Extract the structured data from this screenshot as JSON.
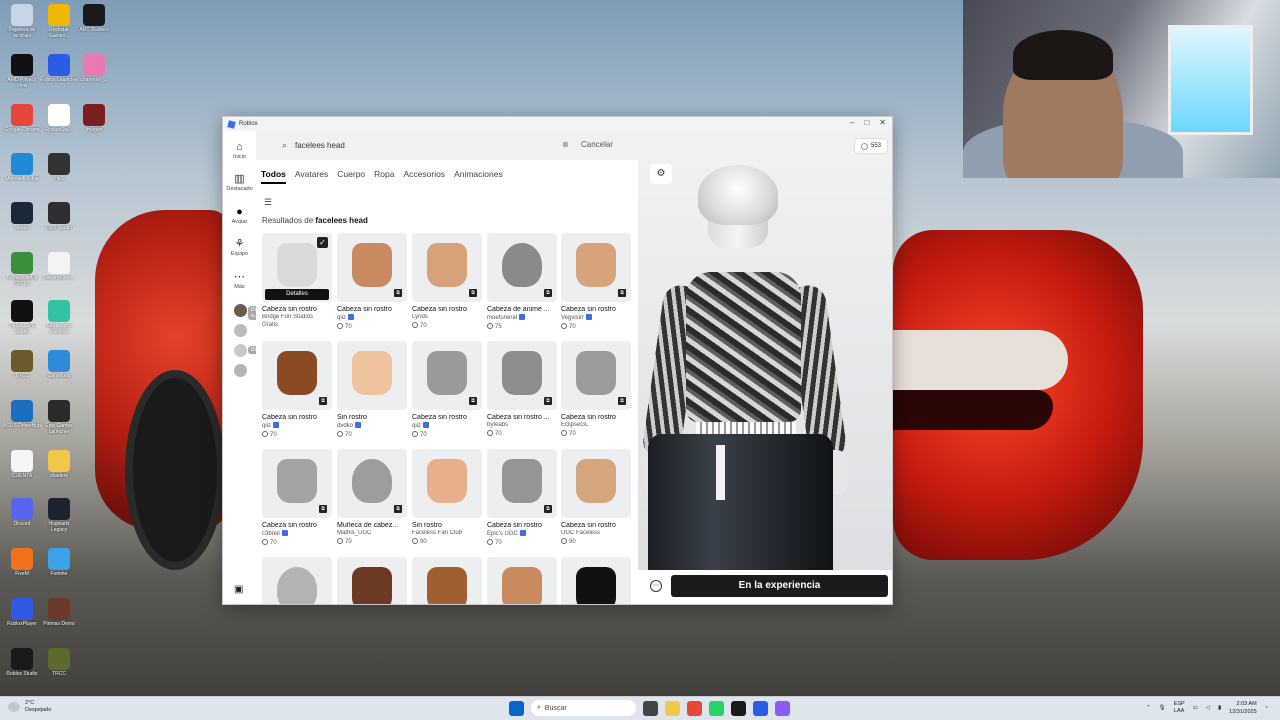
{
  "desktop": {
    "icons": [
      {
        "label": "Papelera de reciclaje",
        "color": "#c7d6e6"
      },
      {
        "label": "Rockstar Games...",
        "color": "#f2b705"
      },
      {
        "label": "ARC Raiders",
        "color": "#1a1a1a"
      },
      {
        "label": "AMD Privacy View",
        "color": "#111111"
      },
      {
        "label": "Roblox Launcher",
        "color": "#2d5be3"
      },
      {
        "label": "chanrexx_...",
        "color": "#e87ab0"
      },
      {
        "label": "Google Chrome",
        "color": "#e9463a"
      },
      {
        "label": "RobloxStu...",
        "color": "#ffffff"
      },
      {
        "label": "Imágen",
        "color": "#7a1f1f"
      },
      {
        "label": "Microsoft Edge",
        "color": "#1e8ad8"
      },
      {
        "label": "HitS",
        "color": "#333333"
      },
      {
        "label": "Steam",
        "color": "#1b2838"
      },
      {
        "label": "OBS Studio",
        "color": "#302e31"
      },
      {
        "label": "TechPowerUp GPU-Z",
        "color": "#3b8f3b"
      },
      {
        "label": "StreamElem...",
        "color": "#f3f3f3"
      },
      {
        "label": "TikTok LIVE Studio",
        "color": "#111111"
      },
      {
        "label": "Streamlabs Desktop",
        "color": "#31c3a2"
      },
      {
        "label": "TRCC",
        "color": "#6a5a2c"
      },
      {
        "label": "Gameloop",
        "color": "#2f8ad8"
      },
      {
        "label": "ASUS DriverHub",
        "color": "#1b6fc2"
      },
      {
        "label": "Epic Games Launcher",
        "color": "#2a2a2a"
      },
      {
        "label": "CUENTA",
        "color": "#f5f5f5"
      },
      {
        "label": "shaders",
        "color": "#f3c84a"
      },
      {
        "label": "Discord",
        "color": "#5865f2"
      },
      {
        "label": "Hogwarts Legacy",
        "color": "#1d2430"
      },
      {
        "label": "FiveM",
        "color": "#f2711c"
      },
      {
        "label": "Fortnite",
        "color": "#3da3e8"
      },
      {
        "label": "RobloxPlayer",
        "color": "#2d5be3"
      },
      {
        "label": "Pirimas Demo",
        "color": "#6b3a2a"
      },
      {
        "label": "Roblox Studio",
        "color": "#1a1a1a"
      },
      {
        "label": "TRCC",
        "color": "#5a6b2c"
      }
    ]
  },
  "window": {
    "title": "Roblox",
    "controls": {
      "minimize": "–",
      "maximize": "□",
      "close": "✕"
    }
  },
  "sidebar": {
    "items": [
      {
        "label": "Inicio",
        "icon": "⌂"
      },
      {
        "label": "Destacado",
        "icon": "▥"
      },
      {
        "label": "Avatar",
        "icon": "●"
      },
      {
        "label": "Equipo",
        "icon": "⚘"
      },
      {
        "label": "Más",
        "icon": "⋯"
      }
    ],
    "popups": [
      "Diseñar a...",
      "Diseñar"
    ],
    "bottom_icon": "▣"
  },
  "search": {
    "query": "facelees head",
    "clear_icon": "⊗",
    "cancel_label": "Cancelar"
  },
  "robux": {
    "amount": "553"
  },
  "tabs": [
    "Todos",
    "Avatares",
    "Cuerpo",
    "Ropa",
    "Accesorios",
    "Animaciones"
  ],
  "results": {
    "prefix": "Resultados de ",
    "query": "facelees head"
  },
  "details_label": "Detalles",
  "items": [
    {
      "name": "Cabeza sin rostro",
      "creator": "Bridge Fun Studios",
      "verified": false,
      "price": "Gratis",
      "color": "#d9d9d9",
      "badge": false,
      "selected": true
    },
    {
      "name": "Cabeza sin rostro",
      "creator": "qiiz",
      "verified": true,
      "price": "70",
      "color": "#c98a62",
      "badge": true,
      "selected": false
    },
    {
      "name": "Cabeza sin rostro",
      "creator": "Lyrids",
      "verified": false,
      "price": "70",
      "color": "#d7a27a",
      "badge": true,
      "selected": false
    },
    {
      "name": "Cabeza de anime ...",
      "creator": "moefuneral",
      "verified": true,
      "price": "75",
      "color": "#8a8a8a",
      "badge": true,
      "selected": false,
      "bald": true
    },
    {
      "name": "Cabeza sin rostro",
      "creator": "Vegvisirr",
      "verified": true,
      "price": "70",
      "color": "#d6a37c",
      "badge": true,
      "selected": false
    },
    {
      "name": "Cabeza sin rostro",
      "creator": "qiiz",
      "verified": true,
      "price": "70",
      "color": "#8b4a24",
      "badge": true,
      "selected": false
    },
    {
      "name": "Sin rostro",
      "creator": "dvdko",
      "verified": true,
      "price": "70",
      "color": "#efc39d",
      "badge": false,
      "selected": false
    },
    {
      "name": "Cabeza sin rostro",
      "creator": "qiiz",
      "verified": true,
      "price": "70",
      "color": "#9a9a9a",
      "badge": true,
      "selected": false
    },
    {
      "name": "Cabeza sin rostro ...",
      "creator": "byteabs",
      "verified": false,
      "price": "70",
      "color": "#8d8d8d",
      "badge": true,
      "selected": false
    },
    {
      "name": "Cabeza sin rostro",
      "creator": "EclipseGL",
      "verified": false,
      "price": "70",
      "color": "#9b9b9b",
      "badge": true,
      "selected": false
    },
    {
      "name": "Cabeza sin rostro",
      "creator": "c3breil",
      "verified": true,
      "price": "70",
      "color": "#a3a3a3",
      "badge": true,
      "selected": false
    },
    {
      "name": "Muñeca de cabez...",
      "creator": "Mathis_UGC",
      "verified": false,
      "price": "70",
      "color": "#9d9d9d",
      "badge": true,
      "selected": false,
      "bald": true
    },
    {
      "name": "Sin rostro",
      "creator": "Faceless Fan Club",
      "verified": false,
      "price": "90",
      "color": "#e8b08a",
      "badge": false,
      "selected": false
    },
    {
      "name": "Cabeza sin rostro",
      "creator": "Epic's UGC",
      "verified": true,
      "price": "70",
      "color": "#959595",
      "badge": true,
      "selected": false
    },
    {
      "name": "Cabeza sin rostro",
      "creator": "UGC Faceless",
      "verified": false,
      "price": "90",
      "color": "#d5a57e",
      "badge": false,
      "selected": false
    },
    {
      "name": "",
      "creator": "",
      "verified": false,
      "price": "",
      "color": "#b3b3b3",
      "badge": false,
      "selected": false,
      "bald": true
    },
    {
      "name": "",
      "creator": "",
      "verified": false,
      "price": "",
      "color": "#6b3a22",
      "badge": false,
      "selected": false
    },
    {
      "name": "",
      "creator": "",
      "verified": false,
      "price": "",
      "color": "#a15e33",
      "badge": false,
      "selected": false
    },
    {
      "name": "",
      "creator": "",
      "verified": false,
      "price": "",
      "color": "#c98a5f",
      "badge": false,
      "selected": false
    },
    {
      "name": "",
      "creator": "",
      "verified": false,
      "price": "",
      "color": "#111111",
      "badge": false,
      "selected": false
    }
  ],
  "preview": {
    "settings_icon": "⚙",
    "chat_icon": "⋯",
    "experience_label": "En la experiencia"
  },
  "taskbar": {
    "weather_temp": "2°C",
    "weather_desc": "Despejado",
    "search_label": "Buscar",
    "lang_top": "ESP",
    "lang_bottom": "LAA",
    "time": "2:03 AM",
    "date": "12/31/2025",
    "app_colors": [
      "#0a65c8",
      "#444444",
      "#f3c84a",
      "#e9463a",
      "#25d366",
      "#1a1a1a",
      "#2d5be3",
      "#8a5cf5"
    ]
  }
}
